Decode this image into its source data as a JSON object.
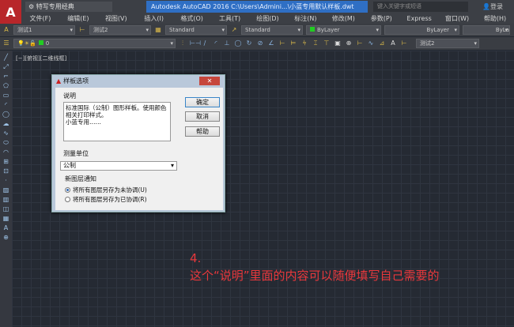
{
  "title_bar": {
    "workspace": "特写专用经典",
    "app_title": "Autodesk AutoCAD 2016    C:\\Users\\Admini...\\小蓝专用默认样板.dwt",
    "search_placeholder": "键入关键字或短语",
    "login": "登录"
  },
  "menu": [
    "文件(F)",
    "编辑(E)",
    "视图(V)",
    "插入(I)",
    "格式(O)",
    "工具(T)",
    "绘图(D)",
    "标注(N)",
    "修改(M)",
    "参数(P)",
    "Express",
    "窗口(W)",
    "帮助(H)"
  ],
  "toolbar1": {
    "text_style": "测试1",
    "dim_style": "测试2",
    "table_style": "Standard",
    "mleader_style": "Standard",
    "color": "ByLayer",
    "linetype": "ByLayer",
    "lineweight": "ByLa"
  },
  "toolbar2": {
    "layer": "0",
    "dim_style2": "测试2"
  },
  "viewport_label": "[−][俯视][二维线框]",
  "dialog": {
    "title": "样板选项",
    "desc_label": "说明",
    "description": "标准国际（公制）图形样板。使用颜色相关打印样式。\n小蓝专用……",
    "ok": "确定",
    "cancel": "取消",
    "help": "帮助",
    "unit_label": "测量单位",
    "unit_value": "公制",
    "notify_label": "新图层通知",
    "radio1": "将所有图层另存为未协调(U)",
    "radio2": "将所有图层另存为已协调(R)",
    "selected": "radio1"
  },
  "annotation": {
    "step": "4.",
    "text": "这个“说明”里面的内容可以随便填写自己需要的"
  },
  "colors": {
    "accent": "#2f6fc4",
    "annotation": "#e8383c",
    "logo": "#b8262a"
  }
}
